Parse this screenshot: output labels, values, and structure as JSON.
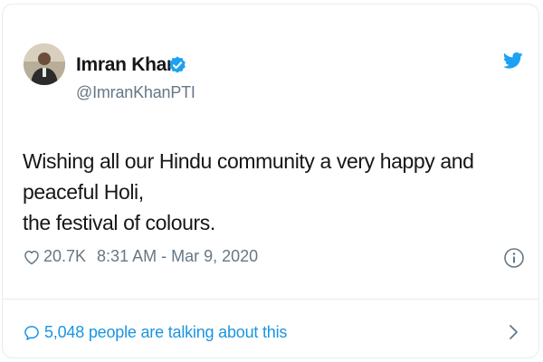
{
  "author": {
    "name": "Imran Khan",
    "handle": "@ImranKhanPTI",
    "verified": true,
    "avatar_icon": "user-avatar"
  },
  "tweet": {
    "text_line1": "Wishing all our Hindu community a very happy and peaceful Holi,",
    "text_line2": "the festival of colours."
  },
  "meta": {
    "likes": "20.7K",
    "timestamp": "8:31 AM - Mar 9, 2020",
    "heart_icon": "heart-icon",
    "info_icon": "info-icon"
  },
  "footer": {
    "talking_text": "5,048 people are talking about this",
    "bubble_icon": "speech-bubble-icon",
    "chevron_icon": "chevron-right-icon"
  },
  "colors": {
    "brand_blue": "#1da1f2",
    "link_blue": "#1b95e0",
    "secondary_text": "#657786",
    "border": "#e6ecf0"
  }
}
